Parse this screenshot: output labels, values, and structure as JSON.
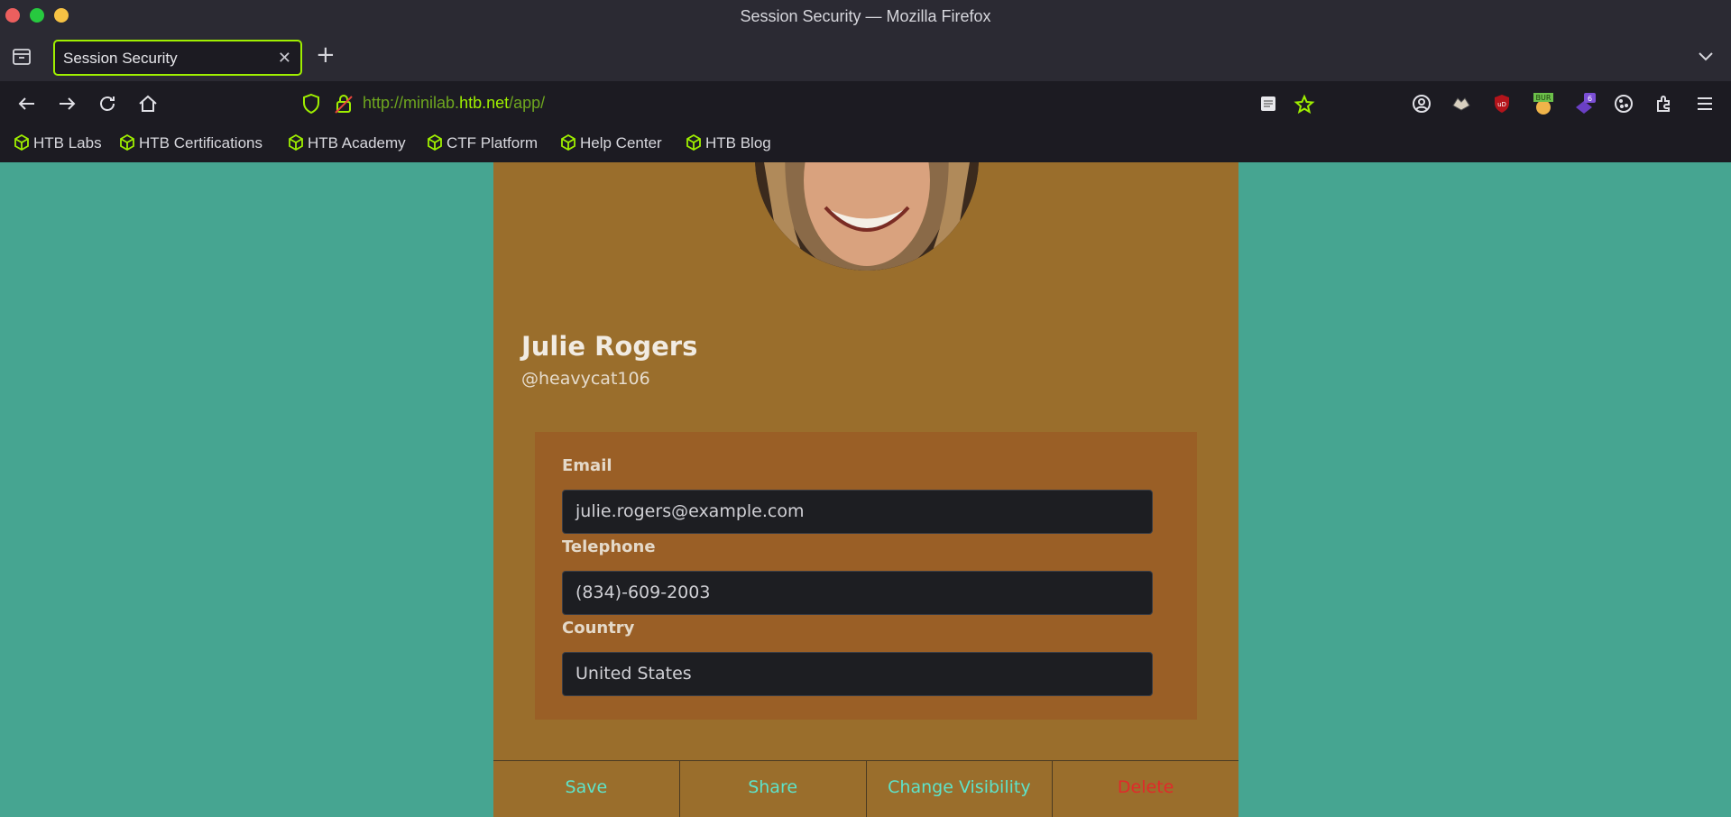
{
  "window": {
    "title": "Session Security — Mozilla Firefox"
  },
  "tabs": [
    {
      "title": "Session Security",
      "active": true
    }
  ],
  "address_bar": {
    "url_prefix": "http://minilab.",
    "url_host": "htb.net",
    "url_suffix": "/app/"
  },
  "bookmarks": [
    {
      "label": "HTB Labs",
      "icon": "cube-icon"
    },
    {
      "label": "HTB Certifications",
      "icon": "cube-icon"
    },
    {
      "label": "HTB Academy",
      "icon": "cube-icon"
    },
    {
      "label": "CTF Platform",
      "icon": "cube-icon"
    },
    {
      "label": "Help Center",
      "icon": "cube-icon"
    },
    {
      "label": "HTB Blog",
      "icon": "cube-icon"
    }
  ],
  "extensions": {
    "burp_badge": "BUR",
    "count_badge": "6"
  },
  "profile": {
    "name": "Julie Rogers",
    "handle": "@heavycat106",
    "fields": [
      {
        "label": "Email",
        "value": "julie.rogers@example.com"
      },
      {
        "label": "Telephone",
        "value": "(834)-609-2003"
      },
      {
        "label": "Country",
        "value": "United States"
      }
    ],
    "actions": [
      {
        "label": "Save"
      },
      {
        "label": "Share"
      },
      {
        "label": "Change Visibility"
      },
      {
        "label": "Delete"
      }
    ]
  },
  "colors": {
    "accent": "#9fef00",
    "page_background": "#46a591",
    "card_background": "#9a6e2c",
    "action_text": "#5ee3c9",
    "danger_text": "#e02a2a"
  }
}
